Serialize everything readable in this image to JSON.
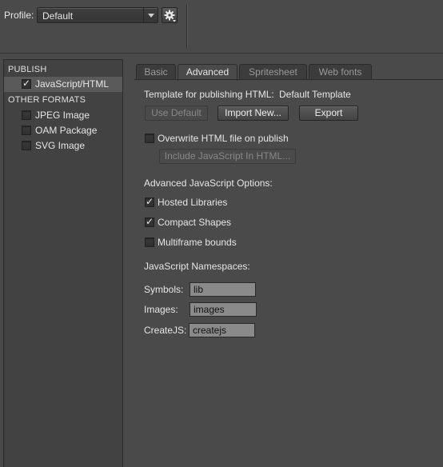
{
  "profile": {
    "label": "Profile:",
    "selected": "Default"
  },
  "sidebar": {
    "publish_heading": "PUBLISH",
    "publish_items": [
      {
        "label": "JavaScript/HTML",
        "checked": true,
        "selected": true
      }
    ],
    "other_heading": "OTHER FORMATS",
    "other_items": [
      {
        "label": "JPEG Image",
        "checked": false
      },
      {
        "label": "OAM Package",
        "checked": false
      },
      {
        "label": "SVG Image",
        "checked": false
      }
    ]
  },
  "tabs": [
    {
      "label": "Basic",
      "active": false
    },
    {
      "label": "Advanced",
      "active": true
    },
    {
      "label": "Spritesheet",
      "active": false
    },
    {
      "label": "Web fonts",
      "active": false
    }
  ],
  "advanced": {
    "template_label": "Template for publishing HTML:",
    "template_value": "Default Template",
    "use_default_label": "Use Default",
    "import_new_label": "Import New...",
    "export_label": "Export",
    "overwrite_label": "Overwrite HTML file on publish",
    "overwrite_checked": false,
    "include_js_label": "Include JavaScript In HTML...",
    "js_options_heading": "Advanced JavaScript Options:",
    "js_options": [
      {
        "label": "Hosted Libraries",
        "checked": true
      },
      {
        "label": "Compact Shapes",
        "checked": true
      },
      {
        "label": "Multiframe bounds",
        "checked": false
      }
    ],
    "namespaces_heading": "JavaScript Namespaces:",
    "namespaces": [
      {
        "label": "Symbols:",
        "value": "lib"
      },
      {
        "label": "Images:",
        "value": "images"
      },
      {
        "label": "CreateJS:",
        "value": "createjs"
      }
    ]
  }
}
